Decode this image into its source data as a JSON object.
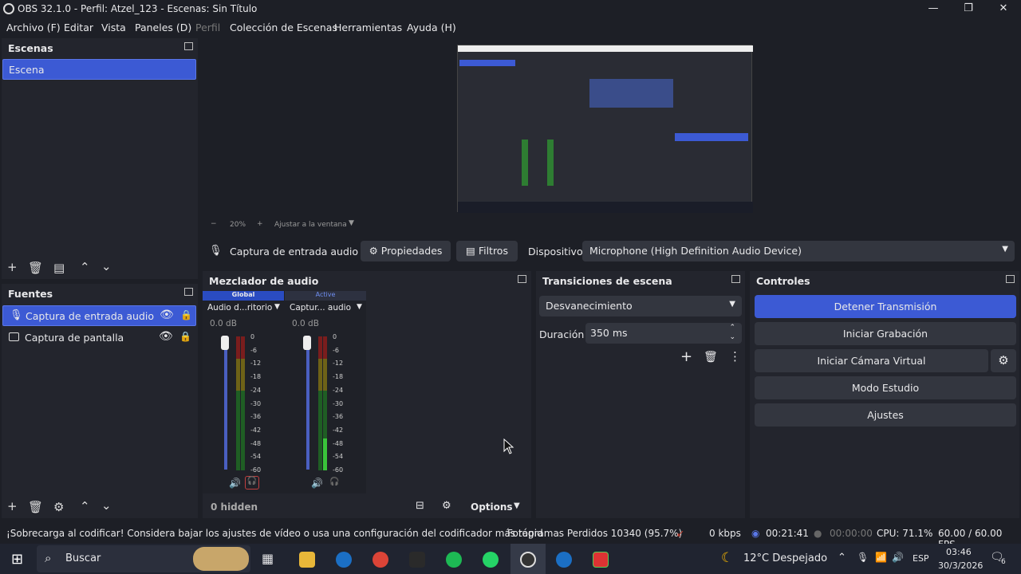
{
  "window": {
    "title": "OBS 32.1.0 - Perfil: Atzel_123 - Escenas: Sin Título"
  },
  "menu": [
    "Archivo (F)",
    "Editar",
    "Vista",
    "Paneles (D)",
    "Perfil",
    "Colección de Escenas",
    "Herramientas",
    "Ayuda (H)"
  ],
  "scenes": {
    "title": "Escenas",
    "items": [
      "Escena"
    ]
  },
  "sources": {
    "title": "Fuentes",
    "items": [
      "Captura de entrada audio",
      "Captura de pantalla"
    ]
  },
  "preview": {
    "zoom": "20%",
    "fit": "Ajustar a la ventana"
  },
  "source_toolbar": {
    "name": "Captura de entrada audio",
    "props": "Propiedades",
    "filters": "Filtros",
    "device_label": "Dispositivo",
    "device_value": "Microphone (High Definition Audio Device)"
  },
  "mixer": {
    "title": "Mezclador de audio",
    "tab_global": "Global",
    "tab_active": "Active",
    "hidden": "0 hidden",
    "options": "Options",
    "channels": [
      {
        "name": "Audio d...ritorio",
        "db": "0.0 dB"
      },
      {
        "name": "Captur... audio",
        "db": "0.0 dB"
      }
    ],
    "ticks": [
      "0",
      "-6",
      "-12",
      "-18",
      "-24",
      "-30",
      "-36",
      "-42",
      "-48",
      "-54",
      "-60"
    ]
  },
  "transitions": {
    "title": "Transiciones de escena",
    "type": "Desvanecimiento",
    "duration_label": "Duración",
    "duration_value": "350 ms"
  },
  "controls": {
    "title": "Controles",
    "stop_stream": "Detener Transmisión",
    "start_rec": "Iniciar Grabación",
    "virtual_cam": "Iniciar Cámara Virtual",
    "studio": "Modo Estudio",
    "settings": "Ajustes"
  },
  "status": {
    "warning": "¡Sobrecarga al codificar! Considera bajar los ajustes de vídeo o usa una configuración del codificador más rápid",
    "frames": "Fotogramas Perdidos 10340 (95.7%)",
    "kbps": "0 kbps",
    "stream_time": "00:21:41",
    "rec_time": "00:00:00",
    "cpu": "CPU: 71.1%",
    "fps": "60.00 / 60.00 FPS"
  },
  "taskbar": {
    "search": "Buscar",
    "weather": "12°C  Despejado",
    "lang": "ESP",
    "time": "03:46",
    "date": "30/3/2026",
    "notif": "6"
  },
  "colors": {
    "accent": "#3c5ad4",
    "bg": "#1d1f26",
    "panel": "#23252d"
  }
}
